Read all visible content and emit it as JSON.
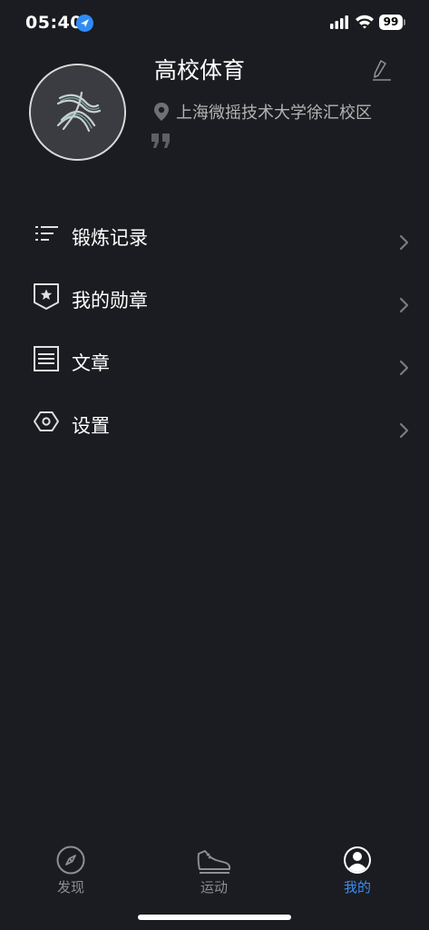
{
  "status_bar": {
    "time": "05:40",
    "battery": "99"
  },
  "profile": {
    "name": "高校体育",
    "location": "上海微摇技术大学徐汇校区"
  },
  "menu": {
    "items": [
      {
        "label": "锻炼记录",
        "icon": "list-icon"
      },
      {
        "label": "我的勋章",
        "icon": "medal-badge-icon"
      },
      {
        "label": "文章",
        "icon": "article-icon"
      },
      {
        "label": "设置",
        "icon": "settings-hexagon-icon"
      }
    ]
  },
  "tabs": [
    {
      "label": "发现",
      "icon": "compass-icon",
      "active": false
    },
    {
      "label": "运动",
      "icon": "sneaker-icon",
      "active": false
    },
    {
      "label": "我的",
      "icon": "user-profile-icon",
      "active": true
    }
  ],
  "colors": {
    "background": "#1b1c21",
    "accent": "#3a8ef0",
    "inactive": "#8e8e93",
    "location_arrow": "#2f8cf7"
  }
}
